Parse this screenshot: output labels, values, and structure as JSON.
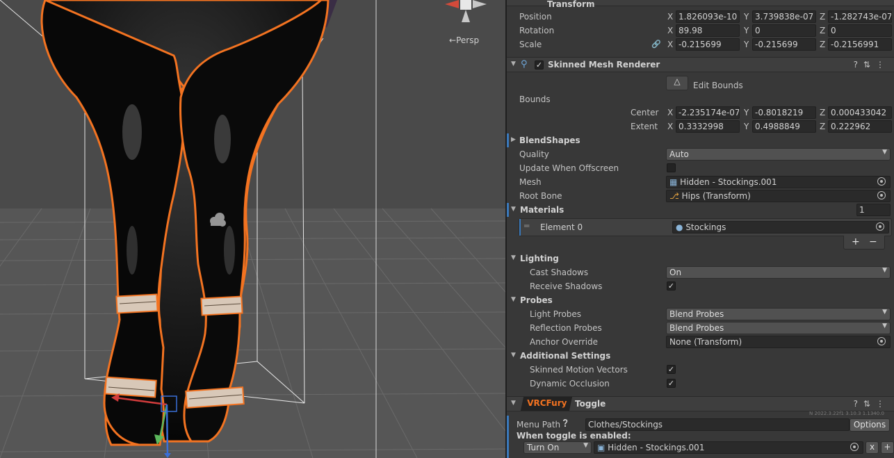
{
  "scene": {
    "view_mode": "Persp",
    "gizmo_arrow": "←"
  },
  "transform": {
    "title": "Transform",
    "position": {
      "label": "Position",
      "x": "1.826093e-10",
      "y": "3.739838e-07",
      "z": "-1.282743e-07"
    },
    "rotation": {
      "label": "Rotation",
      "x": "89.98",
      "y": "0",
      "z": "0"
    },
    "scale": {
      "label": "Scale",
      "x": "-0.215699",
      "y": "-0.215699",
      "z": "-0.2156991"
    },
    "axes": {
      "x": "X",
      "y": "Y",
      "z": "Z"
    }
  },
  "smr": {
    "title": "Skinned Mesh Renderer",
    "edit_bounds": "Edit Bounds",
    "bounds_label": "Bounds",
    "center": {
      "label": "Center",
      "x": "-2.235174e-07",
      "y": "-0.8018219",
      "z": "0.000433042"
    },
    "extent": {
      "label": "Extent",
      "x": "0.3332998",
      "y": "0.4988849",
      "z": "0.222962"
    },
    "blendshapes": "BlendShapes",
    "quality_label": "Quality",
    "quality_value": "Auto",
    "update_offscreen": "Update When Offscreen",
    "mesh_label": "Mesh",
    "mesh_value": "Hidden - Stockings.001",
    "root_bone_label": "Root Bone",
    "root_bone_value": "Hips (Transform)",
    "materials_label": "Materials",
    "materials_count": "1",
    "element0_label": "Element 0",
    "element0_value": "Stockings",
    "plus": "+",
    "minus": "−",
    "lighting": "Lighting",
    "cast_shadows_label": "Cast Shadows",
    "cast_shadows_value": "On",
    "receive_shadows": "Receive Shadows",
    "probes": "Probes",
    "light_probes_label": "Light Probes",
    "light_probes_value": "Blend Probes",
    "reflection_probes_label": "Reflection Probes",
    "reflection_probes_value": "Blend Probes",
    "anchor_override_label": "Anchor Override",
    "anchor_override_value": "None (Transform)",
    "additional": "Additional Settings",
    "skinned_motion": "Skinned Motion Vectors",
    "dynamic_occlusion": "Dynamic Occlusion"
  },
  "vrcfury": {
    "tab": "VRCFury",
    "title": "Toggle",
    "version": "N 2022.3.22f1 3.10.3 1.1340.0",
    "menu_path_label": "Menu Path",
    "menu_path_value": "Clothes/Stockings",
    "options": "Options",
    "when_enabled": "When toggle is enabled:",
    "action_value": "Turn On",
    "action_target": "Hidden - Stockings.001",
    "x_btn": "x",
    "plus_btn": "+"
  },
  "colors": {
    "selection_outline": "#f37321",
    "accent_blue": "#3a79bb",
    "vrcfury_orange": "#f37321"
  }
}
